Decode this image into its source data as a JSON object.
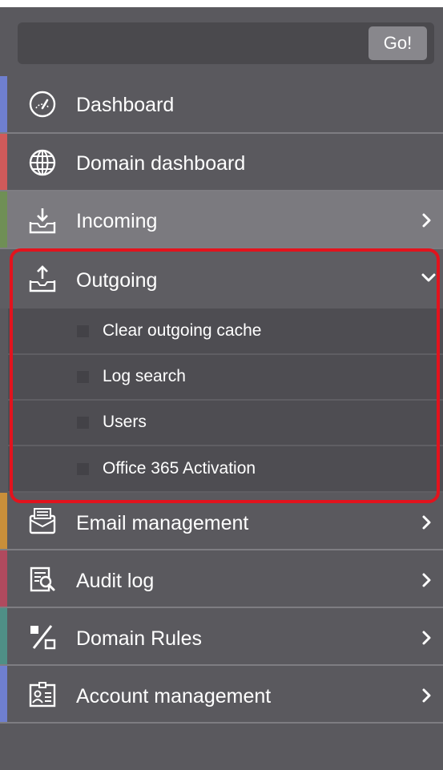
{
  "search": {
    "value": "",
    "placeholder": "",
    "go_label": "Go!"
  },
  "nav": {
    "items": [
      {
        "label": "Dashboard",
        "icon": "speedometer-icon",
        "accent": "#6f7fcf",
        "state": "normal",
        "has_chevron": false
      },
      {
        "label": "Domain dashboard",
        "icon": "globe-icon",
        "accent": "#cf5a5a",
        "state": "normal",
        "has_chevron": false
      },
      {
        "label": "Incoming",
        "icon": "inbox-download-icon",
        "accent": "#6f8f55",
        "state": "active",
        "has_chevron": true,
        "chevron": "chevron-right-icon"
      },
      {
        "label": "Outgoing",
        "icon": "outbox-upload-icon",
        "accent": "",
        "state": "expanded",
        "has_chevron": true,
        "chevron": "chevron-down-icon"
      },
      {
        "label": "Email management",
        "icon": "envelope-icon",
        "accent": "#c98f3a",
        "state": "normal",
        "has_chevron": true,
        "chevron": "chevron-right-icon"
      },
      {
        "label": "Audit log",
        "icon": "audit-log-icon",
        "accent": "#b04a5e",
        "state": "normal",
        "has_chevron": true,
        "chevron": "chevron-right-icon"
      },
      {
        "label": "Domain Rules",
        "icon": "percent-rules-icon",
        "accent": "#4f8f86",
        "state": "normal",
        "has_chevron": true,
        "chevron": "chevron-right-icon"
      },
      {
        "label": "Account management",
        "icon": "id-card-icon",
        "accent": "#6f7fcf",
        "state": "normal",
        "has_chevron": true,
        "chevron": "chevron-right-icon"
      }
    ],
    "outgoing_subitems": [
      {
        "label": "Clear outgoing cache"
      },
      {
        "label": "Log search"
      },
      {
        "label": "Users"
      },
      {
        "label": "Office 365 Activation"
      }
    ]
  },
  "colors": {
    "sidebar_bg": "#5a595e",
    "active_bg": "#7b7a7f",
    "highlight": "#e2131d"
  }
}
